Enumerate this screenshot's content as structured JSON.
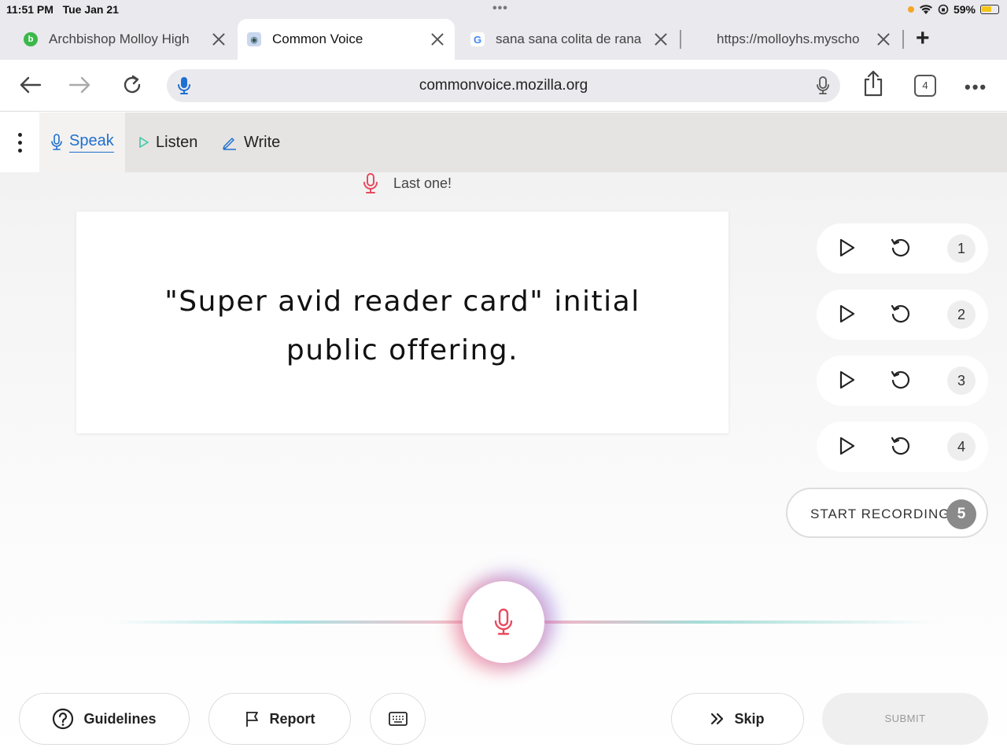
{
  "status": {
    "time": "11:51 PM",
    "date": "Tue Jan 21",
    "battery": "59%"
  },
  "tabs": [
    {
      "title": "Archbishop Molloy High",
      "favicon": "b-icon"
    },
    {
      "title": "Common Voice",
      "favicon": "robot-icon"
    },
    {
      "title": "sana sana colita de rana",
      "favicon": "google-icon"
    },
    {
      "title": "https://molloyhs.myscho",
      "favicon": "none"
    }
  ],
  "toolbar": {
    "url": "commonvoice.mozilla.org",
    "tab_count": "4"
  },
  "nav": {
    "speak": "Speak",
    "listen": "Listen",
    "write": "Write"
  },
  "main": {
    "status_msg": "Last one!",
    "sentence": "\"Super avid reader card\" initial public offering.",
    "recordings": [
      "1",
      "2",
      "3",
      "4"
    ],
    "start_recording": "START RECORDING",
    "next_number": "5"
  },
  "footer": {
    "guidelines": "Guidelines",
    "report": "Report",
    "skip": "Skip",
    "submit": "SUBMIT"
  },
  "colors": {
    "accent": "#1f6fd1",
    "mic_red": "#e8495f",
    "listen_green": "#3cc6a3"
  }
}
